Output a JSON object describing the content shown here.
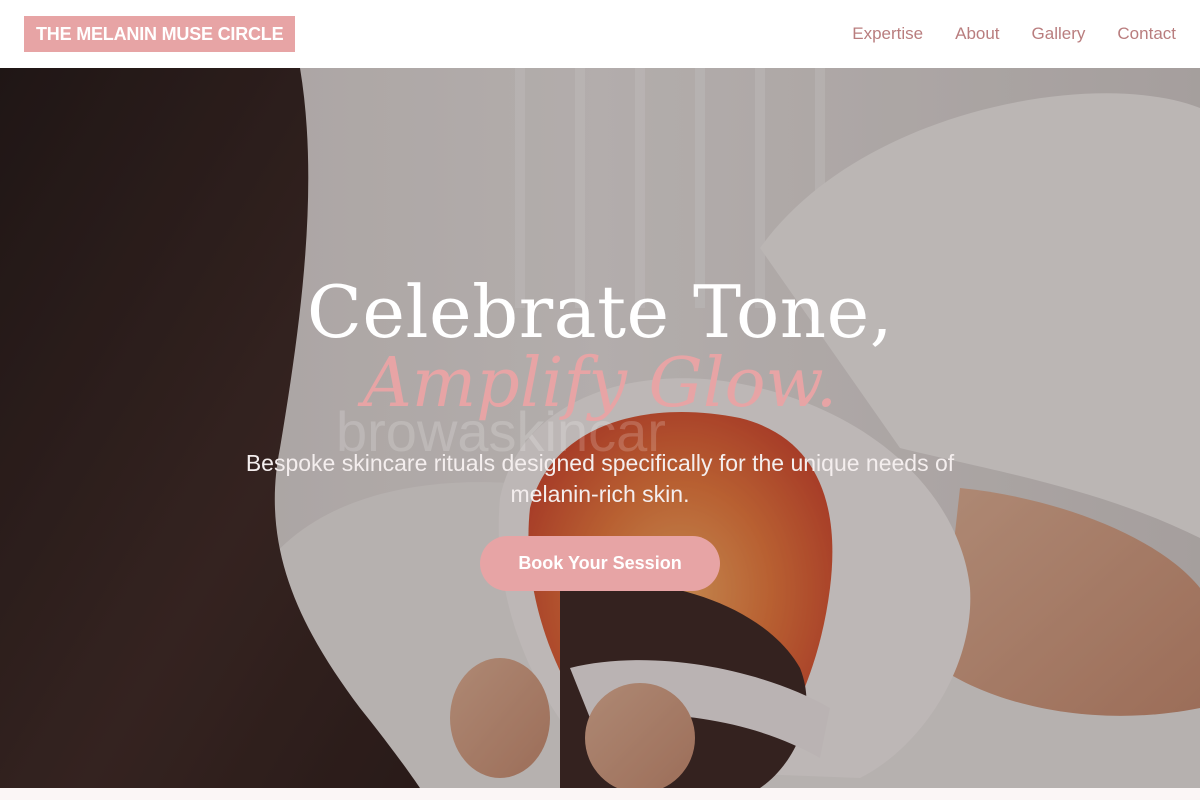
{
  "brand": {
    "logo_text": "THE MELANIN MUSE CIRCLE",
    "accent_color": "#e7a4a5",
    "nav_color": "#b97d7e"
  },
  "nav": {
    "items": [
      {
        "label": "Expertise"
      },
      {
        "label": "About"
      },
      {
        "label": "Gallery"
      },
      {
        "label": "Contact"
      }
    ]
  },
  "hero": {
    "headline_line1": "Celebrate Tone,",
    "headline_line2": "Amplify Glow.",
    "watermark": "browaskincar",
    "subtitle": "Bespoke skincare rituals designed specifically for the unique needs of melanin-rich skin.",
    "cta_label": "Book Your Session",
    "background_image": "esthetician-applying-led-light-therapy-mask-photo"
  }
}
